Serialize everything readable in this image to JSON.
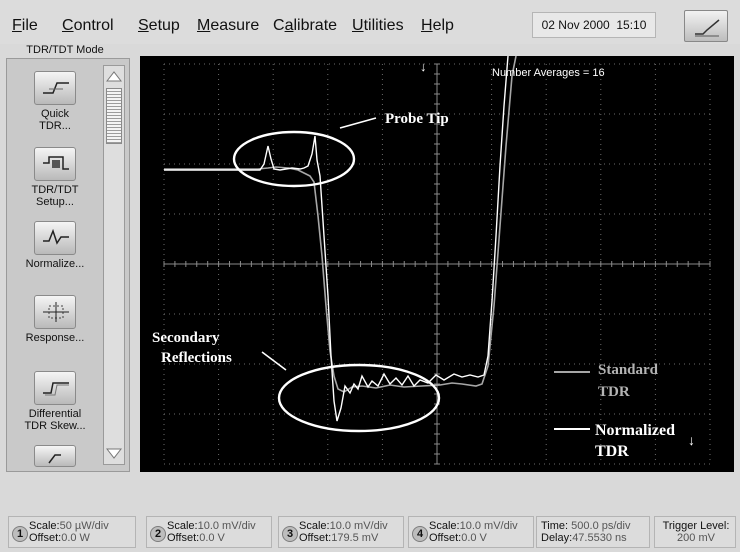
{
  "menu": {
    "items": [
      {
        "pre": "",
        "u": "F",
        "post": "ile"
      },
      {
        "pre": "",
        "u": "C",
        "post": "ontrol"
      },
      {
        "pre": "",
        "u": "S",
        "post": "etup"
      },
      {
        "pre": "",
        "u": "M",
        "post": "easure"
      },
      {
        "pre": "C",
        "u": "a",
        "post": "librate"
      },
      {
        "pre": "",
        "u": "U",
        "post": "tilities"
      },
      {
        "pre": "",
        "u": "H",
        "post": "elp"
      }
    ],
    "date": "02 Nov 2000",
    "time": "15:10",
    "launch_icon": "waveform-launcher-icon"
  },
  "panel": {
    "mode": "TDR/TDT Mode",
    "tools": [
      {
        "line1": "Quick",
        "line2": "TDR...",
        "icon": "quick-tdr-icon"
      },
      {
        "line1": "TDR/TDT",
        "line2": "Setup...",
        "icon": "tdr-setup-icon"
      },
      {
        "line1": "Normalize...",
        "line2": "",
        "icon": "normalize-icon"
      },
      {
        "line1": "Response...",
        "line2": "",
        "icon": "response-icon"
      },
      {
        "line1": "Differential",
        "line2": "TDR Skew...",
        "icon": "differential-skew-icon"
      }
    ]
  },
  "screen": {
    "averages_label": "Number Averages = 16",
    "annotations": {
      "probe_tip": "Probe Tip",
      "secondary_1": "Secondary",
      "secondary_2": "Reflections",
      "standard_1": "Standard",
      "standard_2": "TDR",
      "normalized_1": "Normalized",
      "normalized_2": "TDR"
    },
    "colors": {
      "background": "#000000",
      "standard_trace": "#a6a6a6",
      "normalized_trace": "#ffffff"
    }
  },
  "channels": [
    {
      "num": "1",
      "scale": "50 µW/div",
      "offset": "0.0 W"
    },
    {
      "num": "2",
      "scale": "10.0 mV/div",
      "offset": "0.0 V"
    },
    {
      "num": "3",
      "scale": "10.0 mV/div",
      "offset": "179.5 mV"
    },
    {
      "num": "4",
      "scale": "10.0 mV/div",
      "offset": "0.0 V"
    }
  ],
  "timebase": {
    "time": "500.0 ps/div",
    "delay": "47.5530 ns"
  },
  "trigger": {
    "label": "Trigger Level:",
    "value": "200 mV"
  }
}
